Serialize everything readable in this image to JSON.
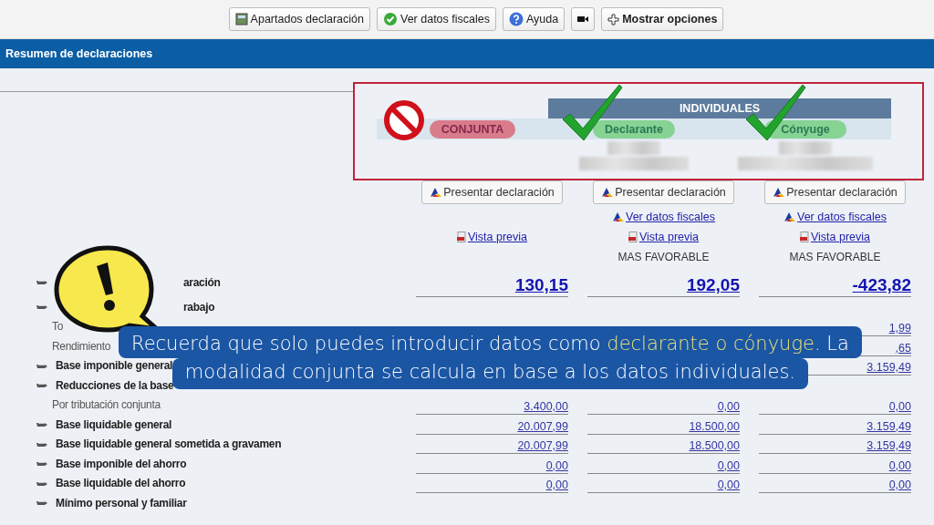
{
  "toolbar": [
    {
      "kind": "calc",
      "label": "Apartados declaración"
    },
    {
      "kind": "check",
      "label": "Ver datos fiscales"
    },
    {
      "kind": "help",
      "label": "Ayuda"
    },
    {
      "kind": "video"
    },
    {
      "kind": "plus",
      "label": "Mostrar opciones",
      "bold": true
    }
  ],
  "section_title": "Resumen de declaraciones",
  "modes": {
    "group_title": "INDIVIDUALES",
    "items": [
      {
        "label": "CONJUNTA",
        "kind": "blocked"
      },
      {
        "label": "Declarante",
        "kind": "allowed"
      },
      {
        "label": "Cónyuge",
        "kind": "allowed"
      }
    ]
  },
  "actions": [
    {
      "button": "Presentar declaración",
      "preview_link": "Vista previa"
    },
    {
      "button": "Presentar declaración",
      "fiscal_link": "Ver datos fiscales",
      "preview_link": "Vista previa",
      "note": "MAS FAVORABLE"
    },
    {
      "button": "Presentar declaración",
      "fiscal_link": "Ver datos fiscales",
      "preview_link": "Vista previa",
      "note": "MAS FAVORABLE"
    }
  ],
  "rows": [
    {
      "kind": "result",
      "label": "aración",
      "cut": true,
      "values": {
        "column_1": "130,15",
        "column_2": "192,05",
        "column_3": "-423,82"
      }
    },
    {
      "kind": "section",
      "label": "rabajo",
      "cut": true
    },
    {
      "kind": "detail",
      "label": "To",
      "values": {
        "column_3": "1,99"
      }
    },
    {
      "kind": "detail",
      "label": "Rendimiento",
      "values": {
        "column_3": ",65"
      }
    },
    {
      "kind": "section",
      "label": "Base imponible general",
      "values": {
        "column_3": "3.159,49"
      }
    },
    {
      "kind": "section",
      "label": "Reducciones de la base"
    },
    {
      "kind": "detail",
      "label": "Por tributación conjunta",
      "values": {
        "column_1": "3.400,00",
        "column_2": "0,00",
        "column_3": "0,00"
      }
    },
    {
      "kind": "section",
      "label": "Base liquidable general",
      "values": {
        "column_1": "20.007,99",
        "column_2": "18.500,00",
        "column_3": "3.159,49"
      }
    },
    {
      "kind": "section",
      "label": "Base liquidable general sometida a gravamen",
      "values": {
        "column_1": "20.007,99",
        "column_2": "18.500,00",
        "column_3": "3.159,49"
      }
    },
    {
      "kind": "section",
      "label": "Base imponible del ahorro",
      "values": {
        "column_1": "0,00",
        "column_2": "0,00",
        "column_3": "0,00"
      }
    },
    {
      "kind": "section",
      "label": "Base liquidable del ahorro",
      "values": {
        "column_1": "0,00",
        "column_2": "0,00",
        "column_3": "0,00"
      }
    },
    {
      "kind": "section",
      "label": "Mínimo personal y familiar"
    }
  ],
  "callout": {
    "line_1": "Recuerda que solo puedes introducir datos como ",
    "highlight": "declarante o cónyuge",
    "line_1_end": ". La",
    "line_2": "modalidad conjunta se calcula en base a los datos individuales."
  }
}
